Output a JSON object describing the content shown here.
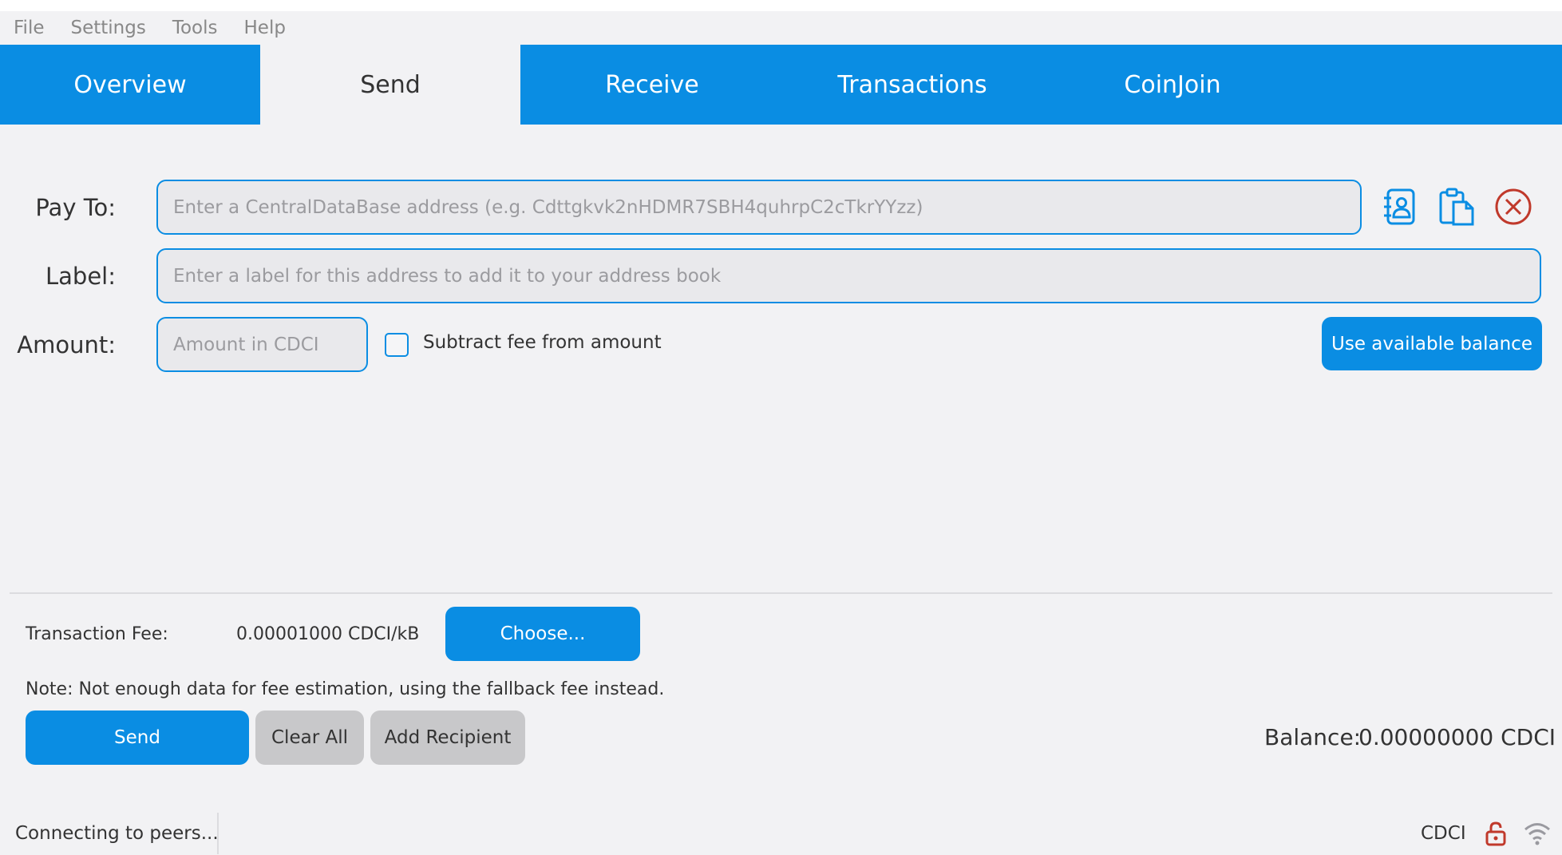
{
  "menu": [
    "File",
    "Settings",
    "Tools",
    "Help"
  ],
  "tabs": [
    "Overview",
    "Send",
    "Receive",
    "Transactions",
    "CoinJoin"
  ],
  "active_tab": "Send",
  "form": {
    "pay_to_label": "Pay To:",
    "pay_to_placeholder": "Enter a CentralDataBase address (e.g. Cdttgkvk2nHDMR7SBH4quhrpC2cTkrYYzz)",
    "label_label": "Label:",
    "label_placeholder": "Enter a label for this address to add it to your address book",
    "amount_label": "Amount:",
    "amount_placeholder": "Amount in CDCI",
    "subtract_fee_label": "Subtract fee from amount",
    "use_balance_label": "Use available balance"
  },
  "icons": {
    "address_book": "address-book-icon",
    "paste": "paste-icon",
    "clear": "clear-x-circle-icon",
    "lock": "lock-icon",
    "network": "wifi-signal-icon"
  },
  "fee": {
    "label": "Transaction Fee:",
    "value": "0.00001000 CDCI/kB",
    "choose_label": "Choose...",
    "note": "Note: Not enough data for fee estimation, using the fallback fee instead."
  },
  "actions": {
    "send": "Send",
    "clear_all": "Clear All",
    "add_recipient": "Add Recipient"
  },
  "balance": {
    "label": "Balance:",
    "value": "0.00000000 CDCI"
  },
  "status": {
    "text": "Connecting to peers...",
    "unit": "CDCI"
  },
  "colors": {
    "accent": "#0a8de3",
    "background": "#f2f2f4",
    "clear_icon": "#c0392b",
    "lock_icon": "#c0392b"
  }
}
